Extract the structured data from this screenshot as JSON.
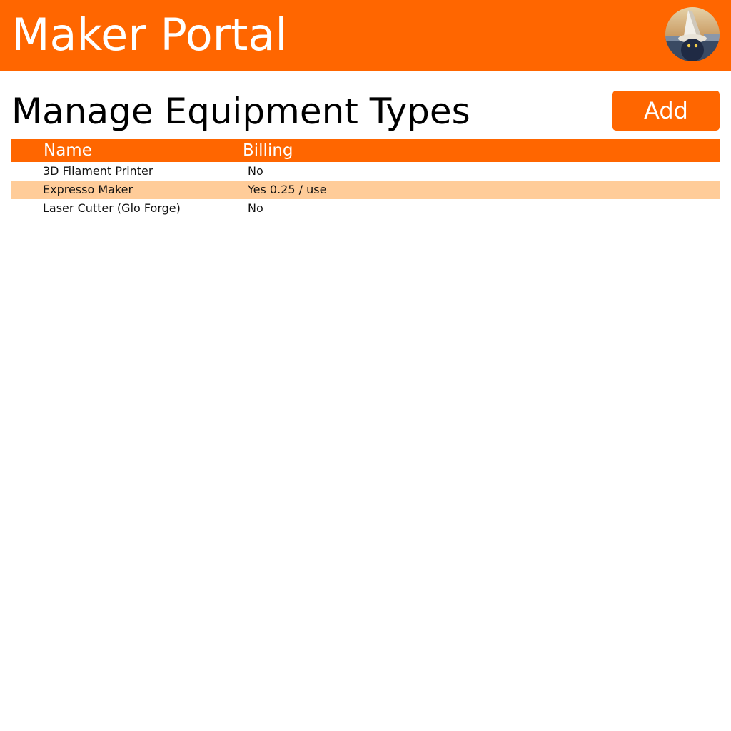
{
  "header": {
    "app_title": "Maker Portal",
    "accent_color": "#ff6600",
    "avatar_icon": "user-avatar-icon"
  },
  "page": {
    "title": "Manage Equipment Types",
    "add_label": "Add"
  },
  "table": {
    "columns": [
      "Name",
      "Billing"
    ],
    "header_color": "#ff6600",
    "alt_row_color": "#ffcc99",
    "rows": [
      {
        "name": "3D Filament Printer",
        "billing": "No"
      },
      {
        "name": "Expresso Maker",
        "billing": "Yes 0.25 / use"
      },
      {
        "name": "Laser Cutter (Glo Forge)",
        "billing": "No"
      }
    ]
  }
}
